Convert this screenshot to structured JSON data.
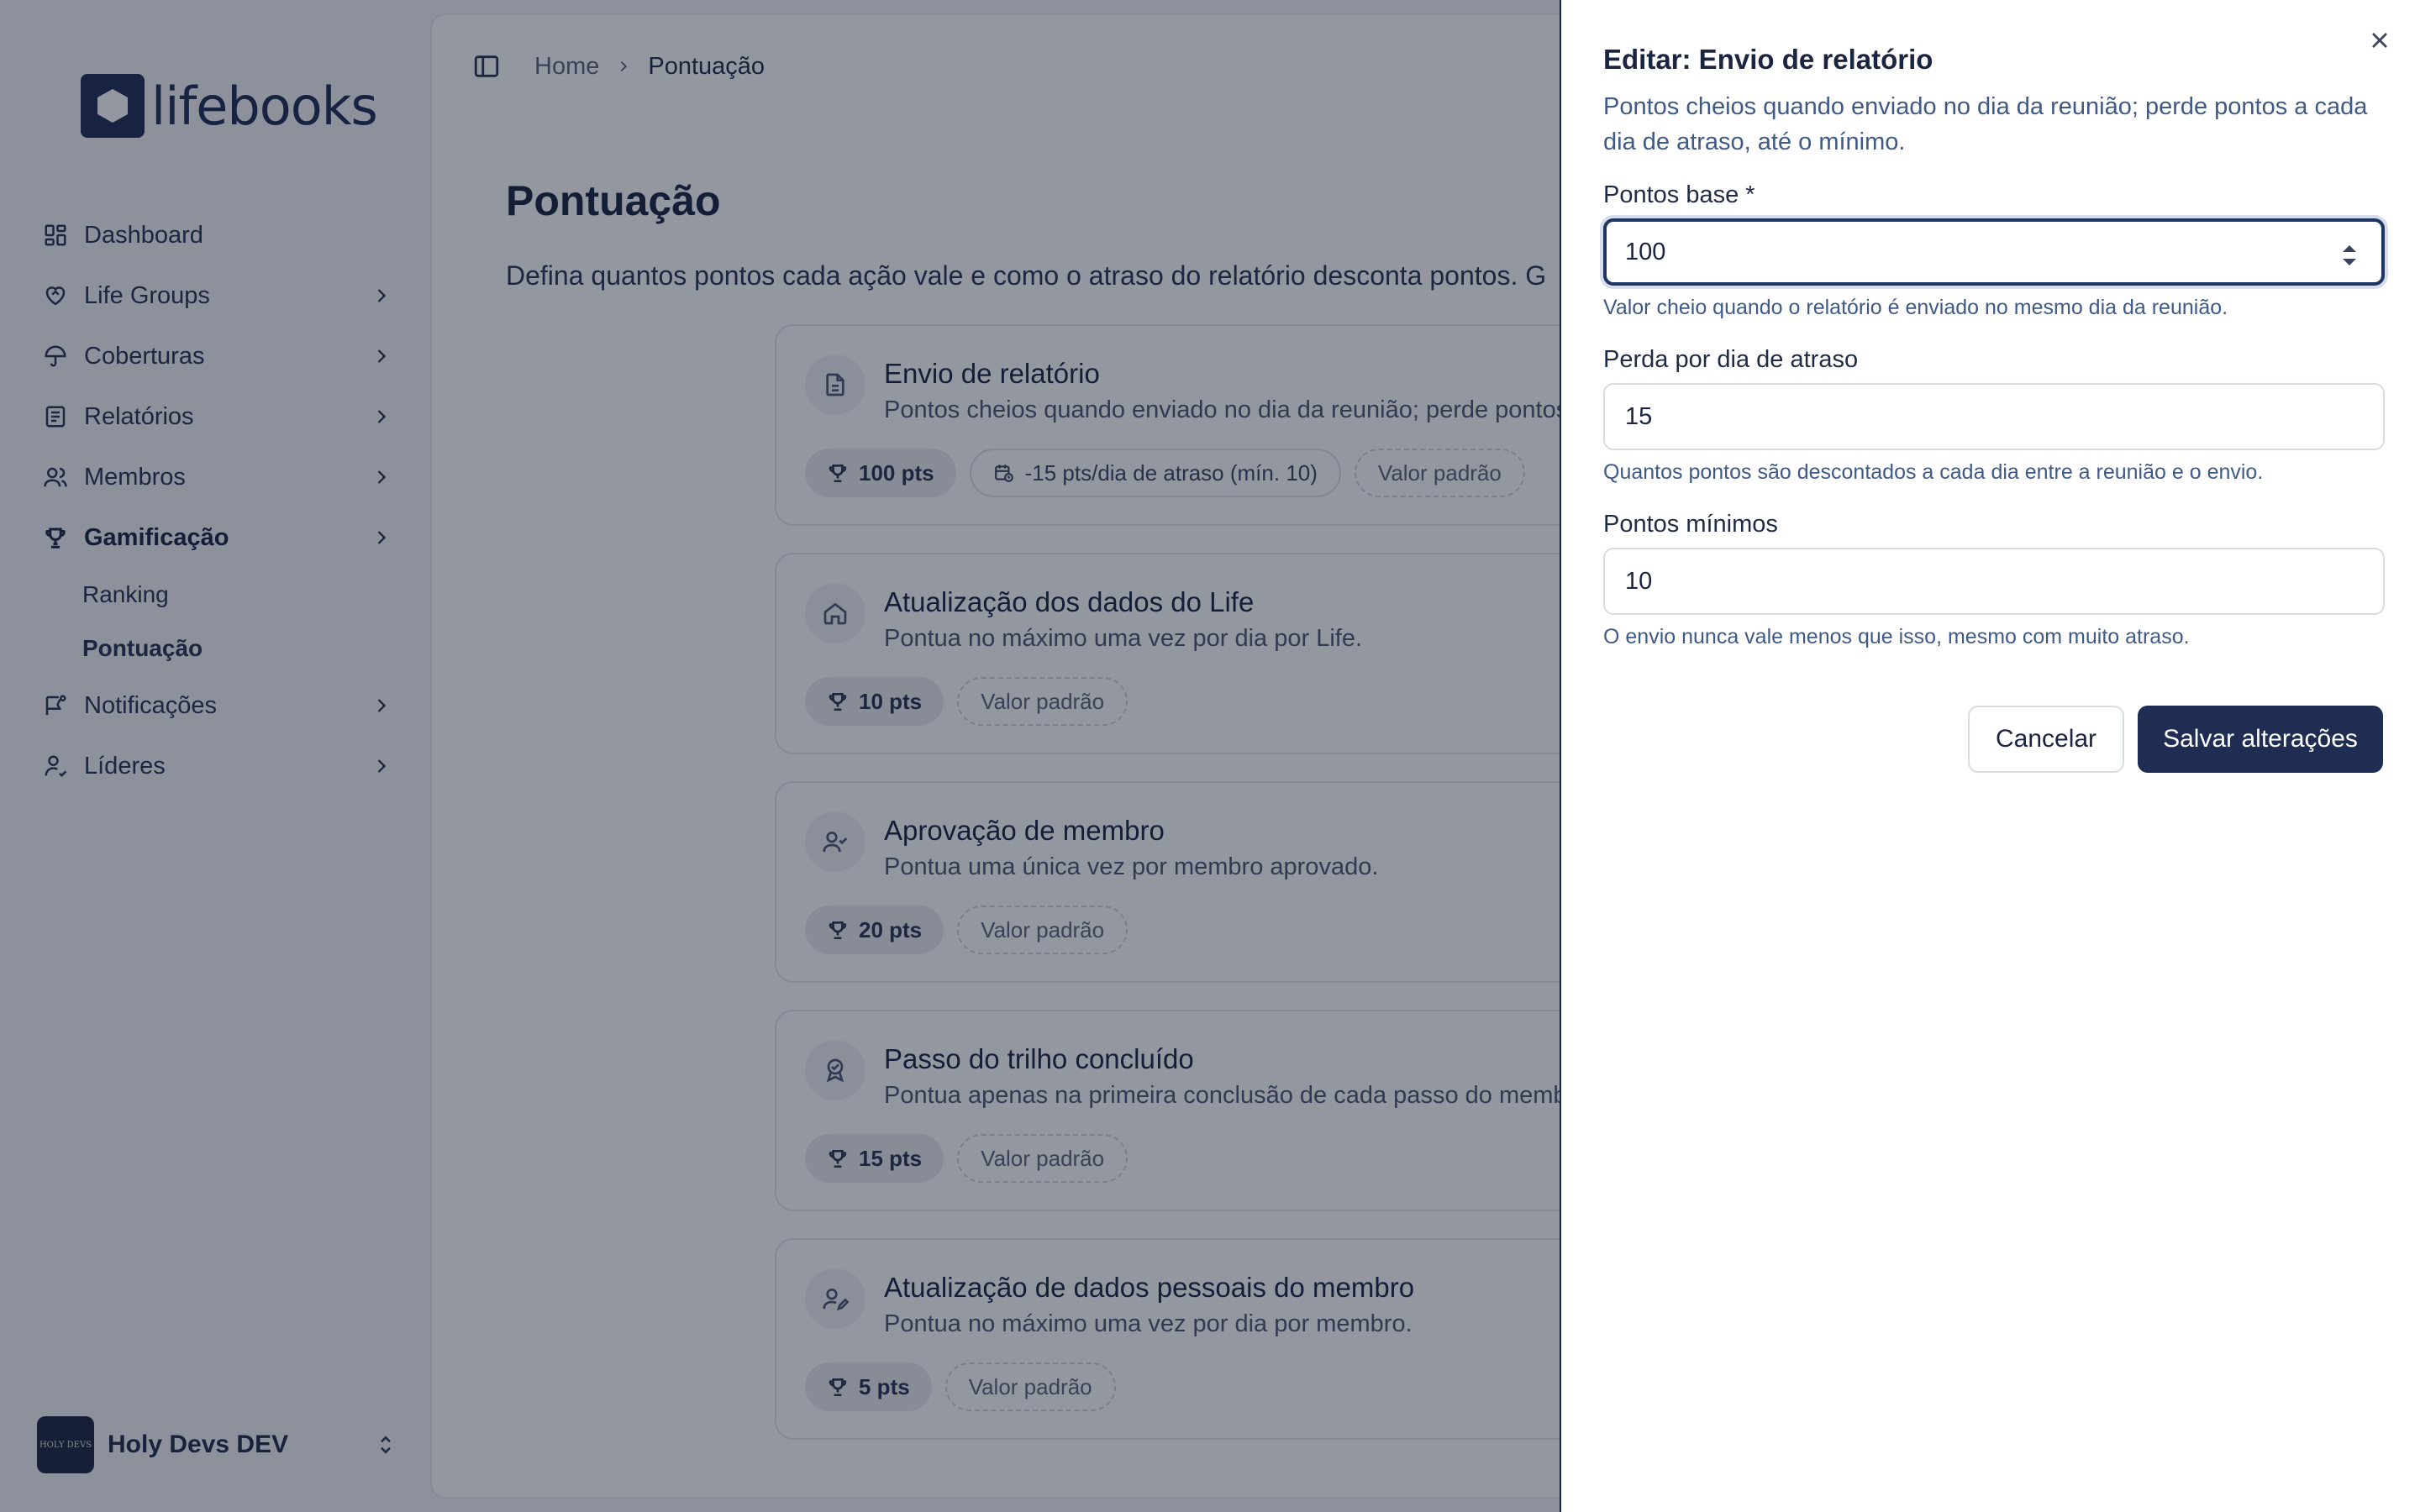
{
  "app": {
    "logo_text": "lifebooks"
  },
  "sidebar": {
    "items": [
      {
        "label": "Dashboard",
        "icon": "dashboard-icon",
        "has_children": false
      },
      {
        "label": "Life Groups",
        "icon": "heart-handshake-icon",
        "has_children": true
      },
      {
        "label": "Coberturas",
        "icon": "umbrella-icon",
        "has_children": true
      },
      {
        "label": "Relatórios",
        "icon": "report-icon",
        "has_children": true
      },
      {
        "label": "Membros",
        "icon": "users-icon",
        "has_children": true
      },
      {
        "label": "Gamificação",
        "icon": "trophy-icon",
        "has_children": true,
        "active": true
      },
      {
        "label": "Notificações",
        "icon": "notification-icon",
        "has_children": true
      },
      {
        "label": "Líderes",
        "icon": "leader-icon",
        "has_children": true
      }
    ],
    "subitems": [
      {
        "label": "Ranking"
      },
      {
        "label": "Pontuação",
        "active": true
      }
    ],
    "workspace": {
      "name": "Holy Devs DEV",
      "avatar_text": "HOLY DEVS"
    }
  },
  "breadcrumb": {
    "home": "Home",
    "current": "Pontuação"
  },
  "page": {
    "title": "Pontuação",
    "description": "Defina quantos pontos cada ação vale e como o atraso do relatório desconta pontos. G"
  },
  "cards": [
    {
      "title": "Envio de relatório",
      "description": "Pontos cheios quando enviado no dia da reunião; perde pontos",
      "points": "100 pts",
      "delay": "-15 pts/dia de atraso (mín. 10)",
      "tag": "Valor padrão",
      "icon": "document-icon"
    },
    {
      "title": "Atualização dos dados do Life",
      "description": "Pontua no máximo uma vez por dia por Life.",
      "points": "10 pts",
      "tag": "Valor padrão",
      "icon": "home-icon"
    },
    {
      "title": "Aprovação de membro",
      "description": "Pontua uma única vez por membro aprovado.",
      "points": "20 pts",
      "tag": "Valor padrão",
      "icon": "user-check-icon"
    },
    {
      "title": "Passo do trilho concluído",
      "description": "Pontua apenas na primeira conclusão de cada passo do memb",
      "points": "15 pts",
      "tag": "Valor padrão",
      "icon": "badge-icon"
    },
    {
      "title": "Atualização de dados pessoais do membro",
      "description": "Pontua no máximo uma vez por dia por membro.",
      "points": "5 pts",
      "tag": "Valor padrão",
      "icon": "user-edit-icon"
    }
  ],
  "drawer": {
    "title": "Editar: Envio de relatório",
    "description": "Pontos cheios quando enviado no dia da reunião; perde pontos a cada dia de atraso, até o mínimo.",
    "fields": {
      "base": {
        "label": "Pontos base *",
        "value": "100",
        "help": "Valor cheio quando o relatório é enviado no mesmo dia da reunião."
      },
      "loss": {
        "label": "Perda por dia de atraso",
        "value": "15",
        "help": "Quantos pontos são descontados a cada dia entre a reunião e o envio."
      },
      "min": {
        "label": "Pontos mínimos",
        "value": "10",
        "help": "O envio nunca vale menos que isso, mesmo com muito atraso."
      }
    },
    "cancel_label": "Cancelar",
    "save_label": "Salvar alterações"
  },
  "colors": {
    "primary": "#1f2d52",
    "overlay": "rgba(15,25,45,0.45)",
    "help_text": "#3f5a86"
  }
}
